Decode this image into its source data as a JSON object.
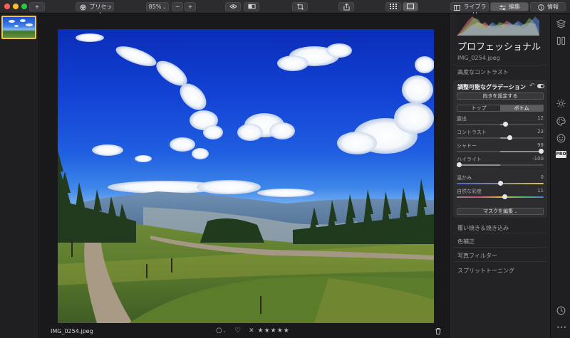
{
  "toolbar": {
    "add_label": "+",
    "preset_label": "プリセット",
    "zoom_value": "85%",
    "zoom_minus": "−",
    "zoom_plus": "+",
    "library_label": "ライブラリ",
    "edit_label": "編集",
    "info_label": "情報"
  },
  "viewer": {
    "filename": "IMG_0254.jpeg",
    "rating_text": "✕ ★★★★★"
  },
  "panel": {
    "title": "プロフェッショナル",
    "filename": "IMG_0254.jpeg",
    "section_top": "高度なコントラスト",
    "tool": {
      "title": "調整可能なグラデーション",
      "set_direction": "向きを設定する",
      "tab_top": "トップ",
      "tab_bottom": "ボトム",
      "mask_edit": "マスクを編集",
      "sliders": [
        {
          "label": "露出",
          "value": "12",
          "position": 0.56
        },
        {
          "label": "コントラスト",
          "value": "23",
          "position": 0.61
        },
        {
          "label": "シャドー",
          "value": "98",
          "position": 0.99
        },
        {
          "label": "ハイライト",
          "value": "-100",
          "position": 0.0
        },
        {
          "label": "温かみ",
          "value": "0",
          "position": 0.5
        },
        {
          "label": "自然な彩度",
          "value": "11",
          "position": 0.55
        }
      ]
    },
    "sections_bottom": [
      "覆い焼き＆焼き込み",
      "色補正",
      "写真フィルター",
      "スプリットトーニング"
    ]
  },
  "icons": [
    "close-dot",
    "minimize-dot",
    "zoom-dot",
    "preset-icon",
    "eye-icon",
    "compare-icon",
    "crop-icon",
    "share-icon",
    "grid-icon",
    "single-view-icon",
    "library-icon",
    "sliders-icon",
    "info-icon",
    "layers-icon",
    "panels-icon",
    "sun-icon",
    "palette-icon",
    "face-icon",
    "clock-icon",
    "trash-icon"
  ],
  "colors": {
    "accent_thumb_border": "#f3c34e",
    "panel_bg": "#232325",
    "card_bg": "#2d2d30"
  }
}
